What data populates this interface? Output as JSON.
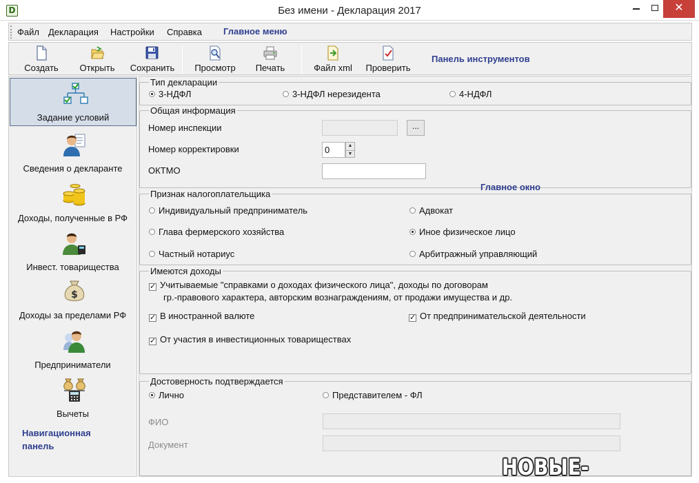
{
  "window": {
    "title": "Без имени - Декларация 2017",
    "logo_letter": "D"
  },
  "menu": {
    "items": [
      "Файл",
      "Декларация",
      "Настройки",
      "Справка"
    ],
    "annotation": "Главное меню"
  },
  "toolbar": {
    "buttons": [
      {
        "label": "Создать",
        "icon": "new-document-icon"
      },
      {
        "label": "Открыть",
        "icon": "open-folder-icon"
      },
      {
        "label": "Сохранить",
        "icon": "floppy-disk-icon"
      },
      {
        "label": "Просмотр",
        "icon": "preview-magnifier-icon"
      },
      {
        "label": "Печать",
        "icon": "printer-icon"
      },
      {
        "label": "Файл xml",
        "icon": "xml-export-icon"
      },
      {
        "label": "Проверить",
        "icon": "check-document-icon"
      }
    ],
    "annotation": "Панель инструментов"
  },
  "nav": {
    "items": [
      {
        "label": "Задание условий",
        "icon": "conditions-tree-icon",
        "active": true
      },
      {
        "label": "Сведения о декларанте",
        "icon": "person-document-icon"
      },
      {
        "label": "Доходы, полученные в РФ",
        "icon": "coins-icon"
      },
      {
        "label": "Инвест. товарищества",
        "icon": "investor-person-icon"
      },
      {
        "label": "Доходы за пределами РФ",
        "icon": "money-bag-icon"
      },
      {
        "label": "Предприниматели",
        "icon": "entrepreneur-icon"
      },
      {
        "label": "Вычеты",
        "icon": "calculator-icon"
      }
    ],
    "annotation_line1": "Навигационная",
    "annotation_line2": "панель"
  },
  "main": {
    "annotation": "Главное окно",
    "decl_type": {
      "legend": "Тип декларации",
      "options": [
        "3-НДФЛ",
        "3-НДФЛ нерезидента",
        "4-НДФЛ"
      ],
      "selected": "3-НДФЛ"
    },
    "general": {
      "legend": "Общая информация",
      "inspection_label": "Номер инспекции",
      "inspection_value": "",
      "browse_label": "...",
      "correction_label": "Номер корректировки",
      "correction_value": "0",
      "oktmo_label": "ОКТМО",
      "oktmo_value": ""
    },
    "taxpayer": {
      "legend": "Признак налогоплательщика",
      "options": [
        "Индивидуальный предприниматель",
        "Адвокат",
        "Глава фермерского хозяйства",
        "Иное физическое лицо",
        "Частный нотариус",
        "Арбитражный управляющий"
      ],
      "selected": "Иное физическое лицо"
    },
    "incomes": {
      "legend": "Имеются доходы",
      "items": [
        {
          "line1": "Учитываемые \"справками о доходах физического лица\", доходы по договорам",
          "line2": "гр.-правового характера, авторским вознаграждениям, от продажи имущества и др.",
          "checked": true
        },
        {
          "label": "В иностранной валюте",
          "checked": true
        },
        {
          "label": "От предпринимательской деятельности",
          "checked": true
        },
        {
          "label": "От участия в инвестиционных товариществах",
          "checked": true
        }
      ]
    },
    "confirm": {
      "legend": "Достоверность подтверждается",
      "options": [
        "Лично",
        "Представителем - ФЛ"
      ],
      "selected": "Лично",
      "fio_label": "ФИО",
      "fio_value": "",
      "doc_label": "Документ",
      "doc_value": ""
    }
  },
  "watermark": "НОВЫЕ-ВАТУТИНКИ.РФ"
}
